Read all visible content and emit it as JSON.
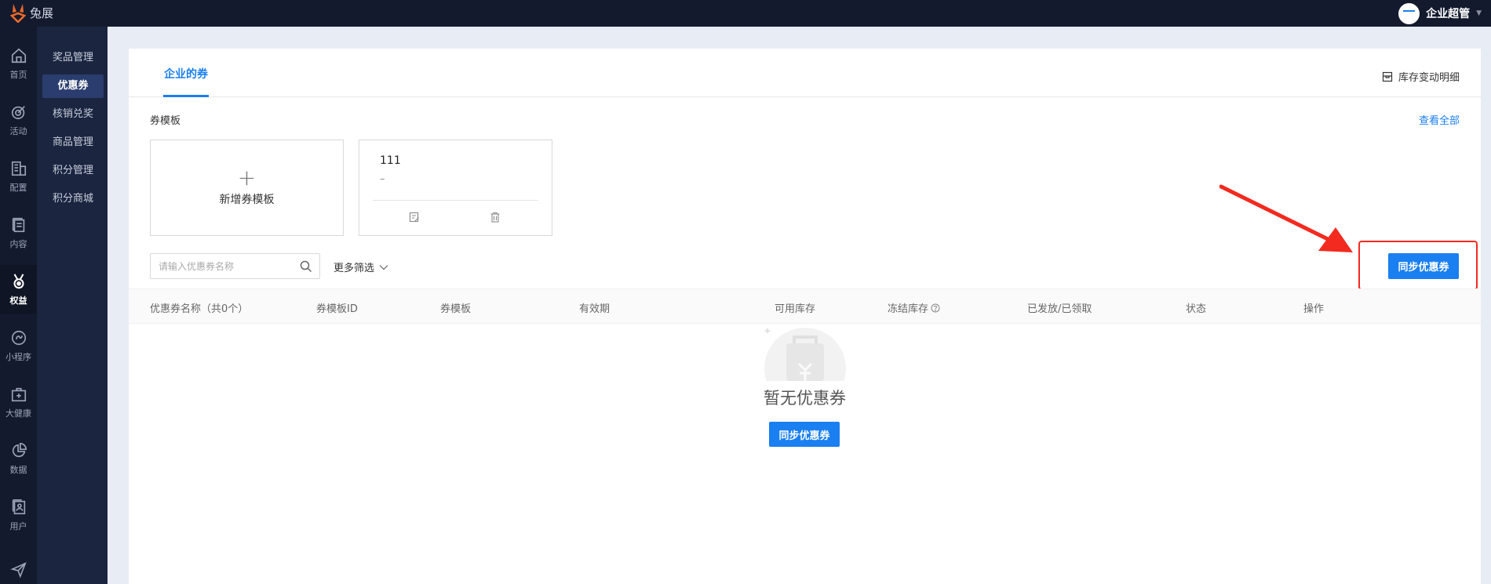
{
  "app": {
    "logo_text": "兔展"
  },
  "user": {
    "name": "企业超管"
  },
  "icon_nav": [
    {
      "label": "首页",
      "icon": "home-icon"
    },
    {
      "label": "活动",
      "icon": "target-icon"
    },
    {
      "label": "配置",
      "icon": "building-icon"
    },
    {
      "label": "内容",
      "icon": "document-icon"
    },
    {
      "label": "权益",
      "icon": "medal-icon",
      "active": true
    },
    {
      "label": "小程序",
      "icon": "link-icon"
    },
    {
      "label": "大健康",
      "icon": "medical-kit-icon"
    },
    {
      "label": "数据",
      "icon": "pie-chart-icon"
    },
    {
      "label": "用户",
      "icon": "contact-book-icon"
    },
    {
      "label": "",
      "icon": "send-icon"
    }
  ],
  "sub_nav": [
    {
      "label": "奖品管理"
    },
    {
      "label": "优惠券",
      "active": true
    },
    {
      "label": "核销兑奖"
    },
    {
      "label": "商品管理"
    },
    {
      "label": "积分管理"
    },
    {
      "label": "积分商城"
    }
  ],
  "tabs": [
    {
      "label": "企业的券",
      "active": true
    }
  ],
  "stock_link": {
    "label": "库存变动明细",
    "icon": "box-icon"
  },
  "templates": {
    "title": "券模板",
    "view_all": "查看全部",
    "add_label": "新增券模板",
    "items": [
      {
        "name": "111",
        "desc": "–"
      }
    ]
  },
  "filters": {
    "search_placeholder": "请输入优惠券名称",
    "more_filter": "更多筛选"
  },
  "actions": {
    "sync_label": "同步优惠券"
  },
  "table": {
    "columns": [
      "优惠券名称（共0个）",
      "券模板ID",
      "券模板",
      "有效期",
      "可用库存",
      "冻结库存",
      "已发放/已领取",
      "状态",
      "操作"
    ]
  },
  "empty": {
    "text": "暂无优惠券",
    "button": "同步优惠券"
  },
  "colors": {
    "primary": "#1a7ff0",
    "sidebar": "#131a2e",
    "highlight": "#f22a1f"
  }
}
